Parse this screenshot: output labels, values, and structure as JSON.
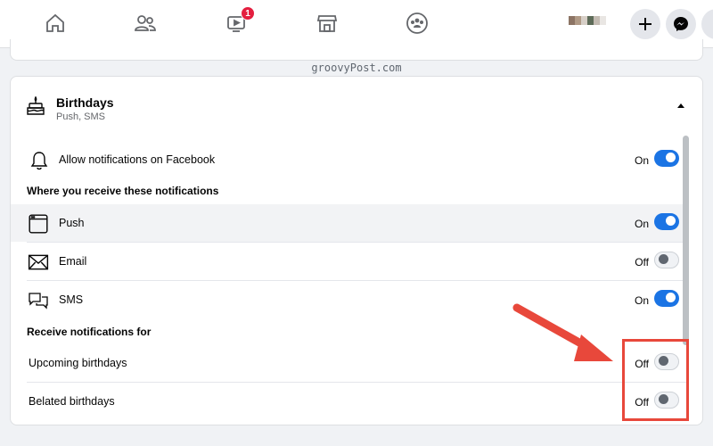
{
  "topbar": {
    "watch_badge": "1",
    "create_label": "+",
    "avatar_colors": [
      "#8c7464",
      "#b09a86",
      "#d7cfc7",
      "#5d6b58",
      "#c3bbb2",
      "#e9e6e3"
    ]
  },
  "watermark": "groovyPost.com",
  "card": {
    "title": "Birthdays",
    "subtitle": "Push, SMS",
    "allow": {
      "label": "Allow notifications on Facebook",
      "state": "On"
    },
    "section_where": "Where you receive these notifications",
    "channels": [
      {
        "label": "Push",
        "state": "On",
        "icon": "browser-window-icon"
      },
      {
        "label": "Email",
        "state": "Off",
        "icon": "envelope-icon"
      },
      {
        "label": "SMS",
        "state": "On",
        "icon": "chat-bubbles-icon"
      }
    ],
    "section_for": "Receive notifications for",
    "types": [
      {
        "label": "Upcoming birthdays",
        "state": "Off"
      },
      {
        "label": "Belated birthdays",
        "state": "Off"
      }
    ]
  },
  "colors": {
    "toggle_on": "#1b74e4",
    "badge": "#e41e3f",
    "annotation": "#e8483b"
  }
}
